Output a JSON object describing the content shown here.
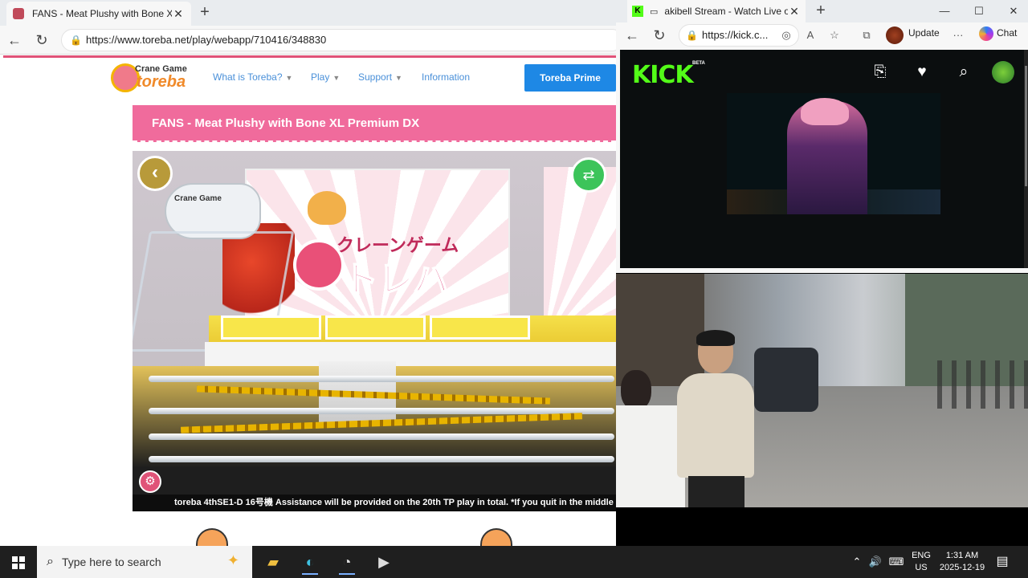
{
  "left_browser": {
    "tab_title": "FANS - Meat Plushy with Bone XL",
    "tab_close": "✕",
    "new_tab": "+",
    "back": "←",
    "refresh": "↻",
    "url": "https://www.toreba.net/play/webapp/710416/348830"
  },
  "toreba": {
    "logo_top": "Crane Game",
    "logo_main": "toreba",
    "menu": [
      {
        "label": "What is Toreba?"
      },
      {
        "label": "Play"
      },
      {
        "label": "Support"
      },
      {
        "label": "Information"
      }
    ],
    "prime_button": "Toreba Prime",
    "prize_title": "FANS - Meat Plushy with Bone XL Premium DX",
    "back_icon": "‹",
    "camera_icon": "⇄",
    "settings_icon": "⚙",
    "machine_jp_top": "クレーンゲーム",
    "machine_jp_main": "トレバ",
    "claw_logo": "Crane Game",
    "ticker": "toreba 4thSE1-D 16号機 Assistance will be provided on the 20th TP play in total. *If you quit in the middle of th"
  },
  "right_browser": {
    "tab_title": "akibell Stream - Watch Live o",
    "tab_close": "✕",
    "new_tab": "+",
    "minimize": "—",
    "maximize": "☐",
    "close": "✕",
    "url": "https://kick.c...",
    "update_label": "Update",
    "more": "···",
    "chat_label": "Chat"
  },
  "kick": {
    "logo": "KICK",
    "beta": "BETA",
    "following_icon": "⎘",
    "heart_icon": "♥",
    "search_icon": "⌕"
  },
  "taskbar": {
    "search_placeholder": "Type here to search",
    "lang_top": "ENG",
    "lang_bottom": "US",
    "time": "1:31 AM",
    "date": "2025-12-19"
  },
  "colors": {
    "toreba_pink": "#f06b9c",
    "prime_blue": "#1e88e5",
    "kick_green": "#53fc18",
    "taskbar_bg": "#1f1f1f"
  }
}
